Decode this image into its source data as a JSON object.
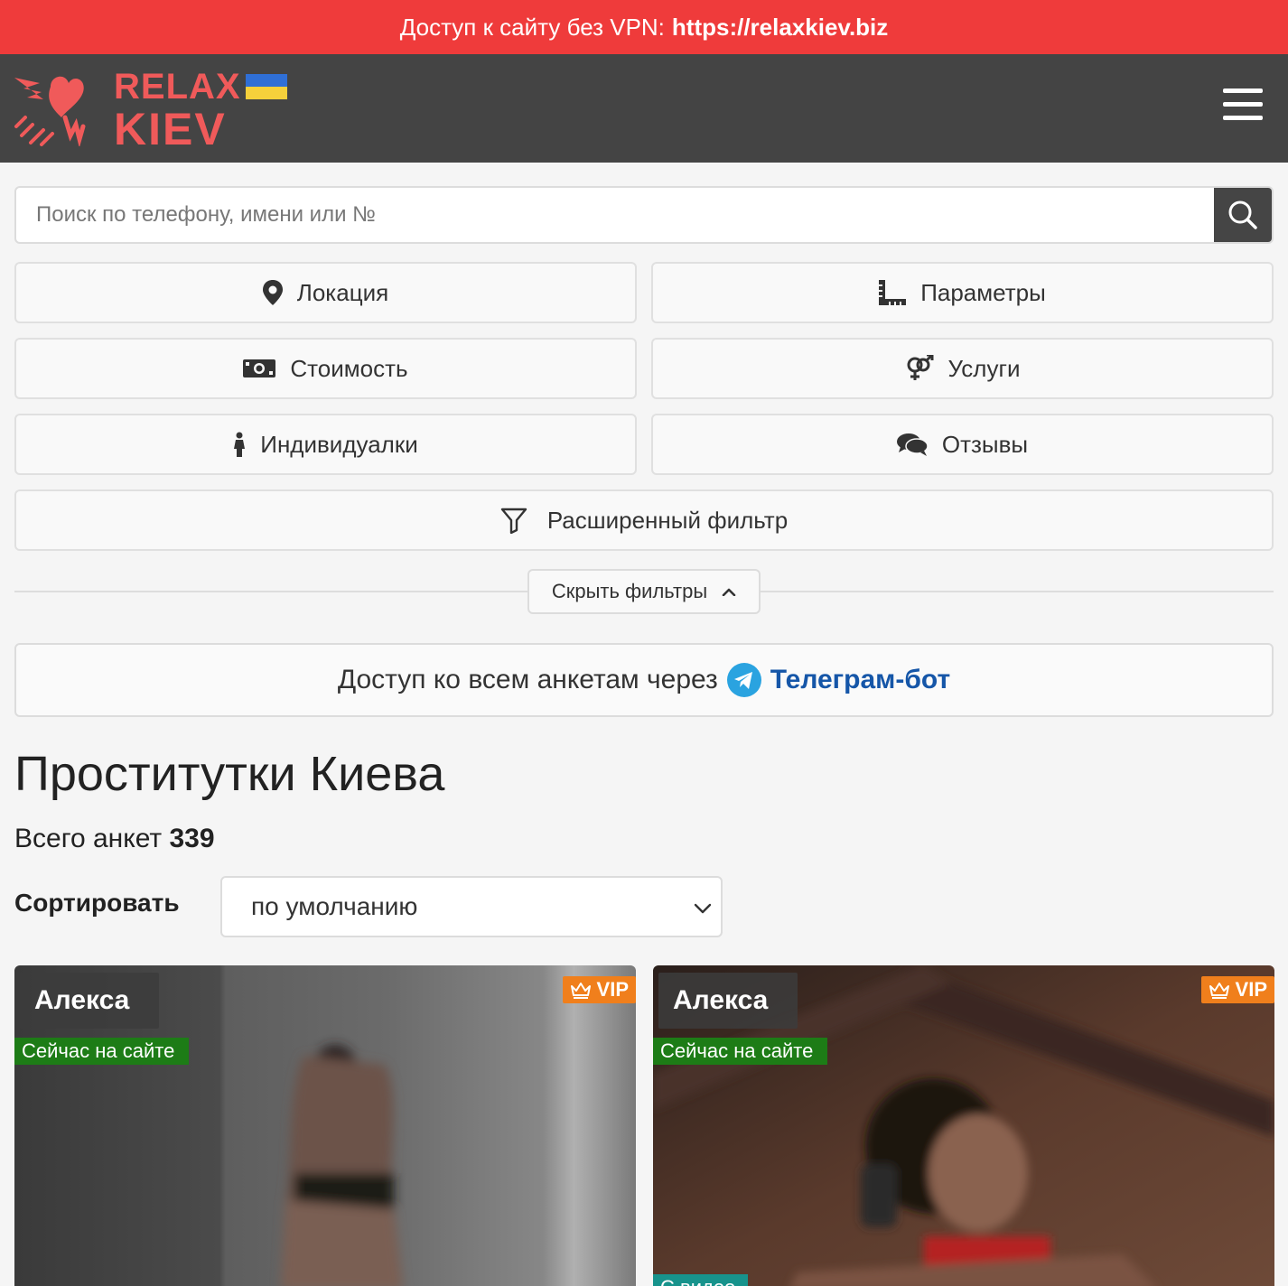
{
  "topbar": {
    "text": "Доступ к сайту без VPN:",
    "link": "https://relaxkiev.biz"
  },
  "header": {
    "logo_line1": "RELAX",
    "logo_line2": "KIEV",
    "menu_icon": "hamburger-icon"
  },
  "search": {
    "placeholder": "Поиск по телефону, имени или №",
    "value": "",
    "icon": "search-icon"
  },
  "filters": {
    "location": {
      "label": "Локация",
      "icon": "map-pin-icon"
    },
    "params": {
      "label": "Параметры",
      "icon": "ruler-icon"
    },
    "price": {
      "label": "Стоимость",
      "icon": "money-icon"
    },
    "services": {
      "label": "Услуги",
      "icon": "gender-icon"
    },
    "individuals": {
      "label": "Индивидуалки",
      "icon": "female-icon"
    },
    "reviews": {
      "label": "Отзывы",
      "icon": "comments-icon"
    },
    "advanced": {
      "label": "Расширенный фильтр",
      "icon": "funnel-icon"
    },
    "hide_label": "Скрыть фильтры"
  },
  "telegram": {
    "text": "Доступ ко всем анкетам через",
    "link": "Телеграм-бот",
    "icon": "telegram-icon"
  },
  "page": {
    "title": "Проститутки Киева",
    "total_label": "Всего анкет",
    "total_value": "339"
  },
  "sort": {
    "label": "Сортировать",
    "selected": "по умолчанию"
  },
  "cards": [
    {
      "name": "Алекса",
      "badge": "VIP",
      "status": "Сейчас на сайте"
    },
    {
      "name": "Алекса",
      "badge": "VIP",
      "status": "Сейчас на сайте",
      "tag": "С видео"
    }
  ],
  "colors": {
    "topbar": "#ef3b3b",
    "header": "#444444",
    "logo": "#f05a5a",
    "vip": "#f07f1c",
    "online": "#1d7c16",
    "video": "#17938c",
    "telegram_link": "#1556a8"
  }
}
